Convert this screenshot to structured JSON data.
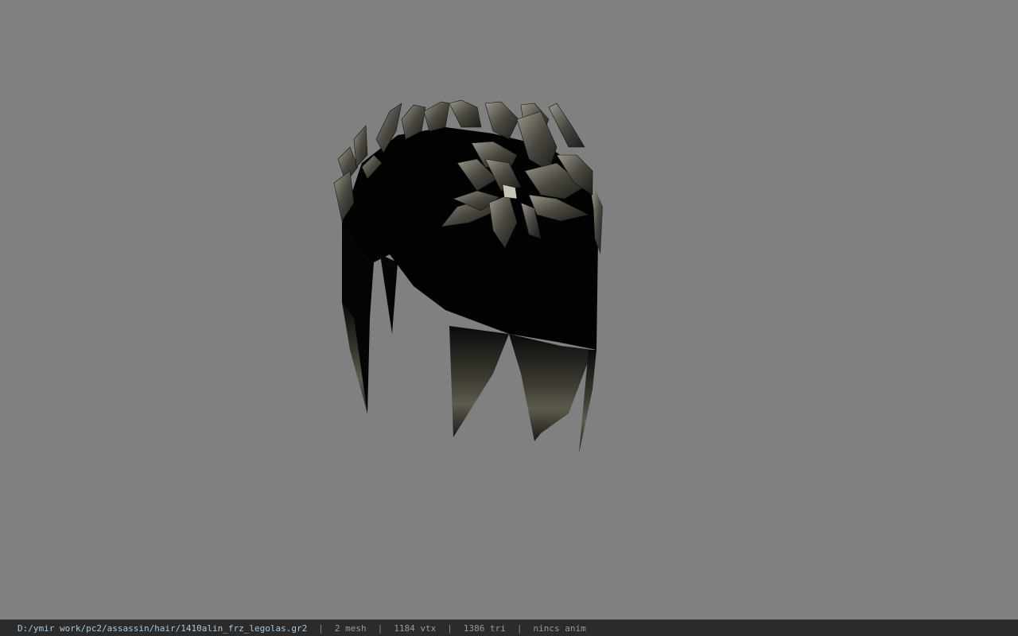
{
  "viewer": {
    "background_color": "#808080",
    "model_icon": "hair-mesh-model"
  },
  "statusbar": {
    "file_path": "D:/ymir work/pc2/assassin/hair/1410alin_frz_legolas.gr2",
    "separator": "|",
    "mesh_count": "2 mesh",
    "vertex_count": "1184 vtx",
    "triangle_count": "1386 tri",
    "anim_status": "nincs anim"
  }
}
